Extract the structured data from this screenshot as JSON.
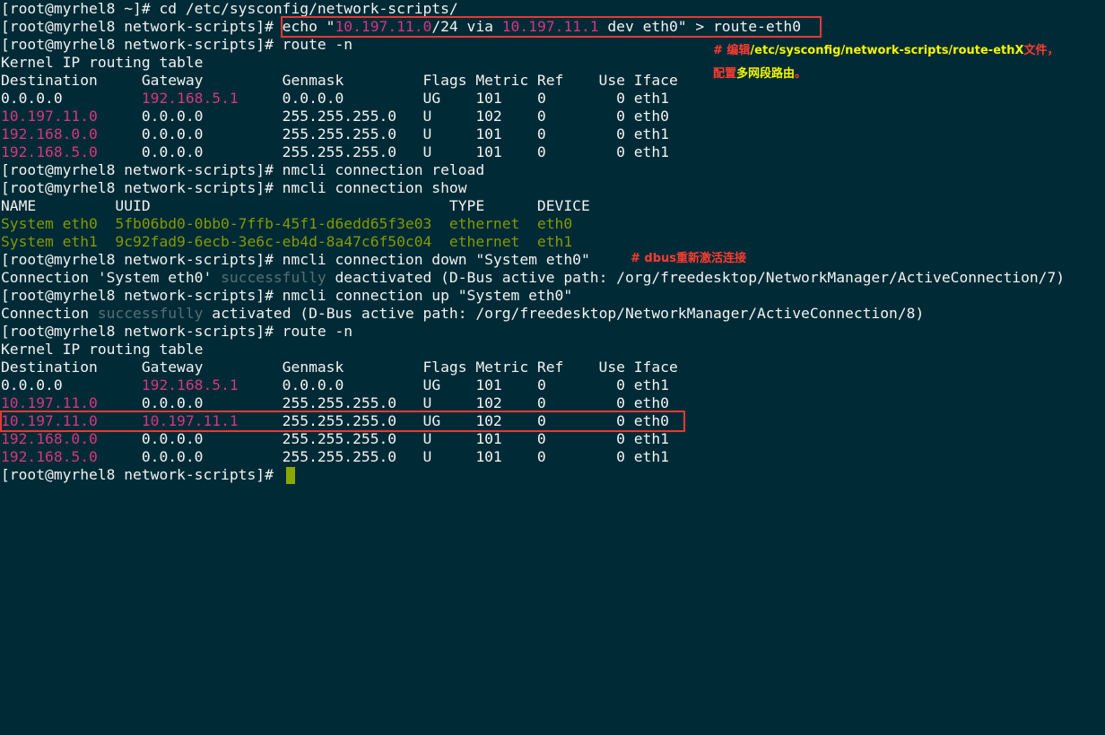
{
  "prompt": "[root@myrhel8 network-scripts]# ",
  "lines": {
    "l01": "[root@myrhel8 ~]# cd /etc/sysconfig/network-scripts/",
    "l02_pre": "[root@myrhel8 network-scripts]# ",
    "l02_a": "echo \"",
    "l02_b": "10.197.11.0",
    "l02_c": "/24 via ",
    "l02_d": "10.197.11.1",
    "l02_e": " dev eth0\" > route-eth0",
    "l03": "[root@myrhel8 network-scripts]# route -n",
    "l04": "Kernel IP routing table",
    "l05": "Destination     Gateway         Genmask         Flags Metric Ref    Use Iface",
    "l06_a": "0.0.0.0         ",
    "l06_b": "192.168.5.1",
    "l06_c": "     0.0.0.0         UG    101    0        0 eth1",
    "l07_a": "10.197.11.0",
    "l07_b": "     0.0.0.0         255.255.255.0   U     102    0        0 eth0",
    "l08_a": "192.168.0.0",
    "l08_b": "     0.0.0.0         255.255.255.0   U     101    0        0 eth1",
    "l09_a": "192.168.5.0",
    "l09_b": "     0.0.0.0         255.255.255.0   U     101    0        0 eth1",
    "l10": "[root@myrhel8 network-scripts]# nmcli connection reload",
    "l11": "[root@myrhel8 network-scripts]# nmcli connection show",
    "l12": "NAME         UUID                                  TYPE      DEVICE",
    "l13_a": "System eth0  5fb06bd0-0bb0-7ffb-45f1-d6edd65f3e03  ethernet  eth0",
    "l14_a": "System eth1  9c92fad9-6ecb-3e6c-eb4d-8a47c6f50c04  ethernet  eth1",
    "l15": "[root@myrhel8 network-scripts]# nmcli connection down \"System eth0\"",
    "l16_a": "Connection 'System eth0' ",
    "l16_b": "successfully",
    "l16_c": " deactivated (D-Bus active path: /org/freedesktop/NetworkManager/ActiveConnection/7)",
    "l17": "[root@myrhel8 network-scripts]# nmcli connection up \"System eth0\"",
    "l18_a": "Connection ",
    "l18_b": "successfully",
    "l18_c": " activated (D-Bus active path: /org/freedesktop/NetworkManager/ActiveConnection/8)",
    "l19": "[root@myrhel8 network-scripts]# route -n",
    "l20": "Kernel IP routing table",
    "l21": "Destination     Gateway         Genmask         Flags Metric Ref    Use Iface",
    "l22_a": "0.0.0.0         ",
    "l22_b": "192.168.5.1",
    "l22_c": "     0.0.0.0         UG    101    0        0 eth1",
    "l23_a": "10.197.11.0",
    "l23_b": "     0.0.0.0         255.255.255.0   U     102    0        0 eth0",
    "l24_a": "10.197.11.0",
    "l24_b": "     ",
    "l24_c": "10.197.11.1",
    "l24_d": "     255.255.255.0   UG    102    0        0 eth0",
    "l25_a": "192.168.0.0",
    "l25_b": "     0.0.0.0         255.255.255.0   U     101    0        0 eth1",
    "l26_a": "192.168.5.0",
    "l26_b": "     0.0.0.0         255.255.255.0   U     101    0        0 eth1",
    "l27": "[root@myrhel8 network-scripts]# "
  },
  "annotations": {
    "note1_a": "# 编辑",
    "note1_b": "/etc/sysconfig/network-scripts/route-ethX",
    "note1_c": "文件，",
    "note1_d": "配置",
    "note1_e": "多网段路由",
    "note1_f": "。",
    "note2": "# dbus重新激活连接"
  },
  "colors": {
    "background": "#002b36",
    "text": "#f2f2f2",
    "ip_highlight": "#d33682",
    "connection_name": "#859900",
    "dim": "#586e75",
    "box": "#e53935",
    "note_red": "#ff3b30",
    "note_yellow": "#f5f500"
  }
}
